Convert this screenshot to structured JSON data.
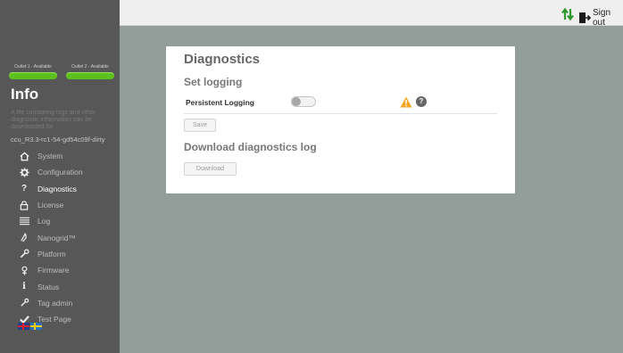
{
  "sidebar": {
    "outlets": [
      {
        "label": "Outlet 1 - Available",
        "status_color": "#5cc11e"
      },
      {
        "label": "Outlet 2 - Available",
        "status_color": "#5cc11e"
      }
    ],
    "section_title": "Info",
    "section_description": "A file containing logs and other diagnostic information can be downloaded for",
    "version": "ccu_R3.3-rc1-54-gd54c09f-dirty",
    "nav": [
      {
        "label": "System",
        "icon": "home-icon",
        "active": false
      },
      {
        "label": "Configuration",
        "icon": "gear-icon",
        "active": false
      },
      {
        "label": "Diagnostics",
        "icon": "question-icon",
        "active": true
      },
      {
        "label": "License",
        "icon": "lock-icon",
        "active": false
      },
      {
        "label": "Log",
        "icon": "list-icon",
        "active": false
      },
      {
        "label": "Nanogrid™",
        "icon": "nanogrid-icon",
        "active": false
      },
      {
        "label": "Platform",
        "icon": "wrench-icon",
        "active": false
      },
      {
        "label": "Firmware",
        "icon": "firmware-icon",
        "active": false
      },
      {
        "label": "Status",
        "icon": "info-icon",
        "active": false
      },
      {
        "label": "Tag admin",
        "icon": "tag-icon",
        "active": false
      },
      {
        "label": "Test Page",
        "icon": "check-icon",
        "active": false
      }
    ],
    "languages": [
      "english-flag-icon",
      "swedish-flag-icon"
    ]
  },
  "topbar": {
    "sort_icon": "sort-arrows-icon",
    "signout_label": "Sign out",
    "signout_icon": "door-exit-icon",
    "accent_color": "#2e9a2e"
  },
  "main": {
    "title": "Diagnostics",
    "logging_heading": "Set logging",
    "persistent_logging_label": "Persistent Logging",
    "persistent_logging_enabled": false,
    "save_label": "Save",
    "download_heading": "Download diagnostics log",
    "download_label": "Download",
    "warning_color": "#f5a623"
  }
}
